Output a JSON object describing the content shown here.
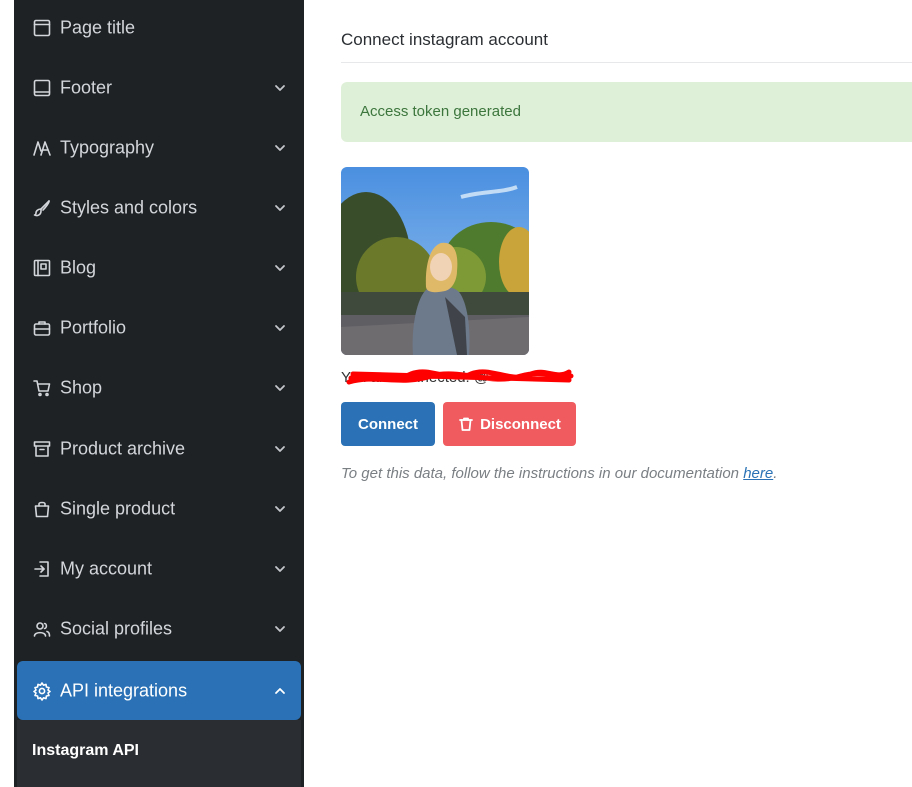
{
  "sidebar": {
    "items": [
      {
        "label": "Page title",
        "icon": "page-icon",
        "has_chevron": false
      },
      {
        "label": "Footer",
        "icon": "footer-icon",
        "has_chevron": true
      },
      {
        "label": "Typography",
        "icon": "typography-icon",
        "has_chevron": true
      },
      {
        "label": "Styles and colors",
        "icon": "brush-icon",
        "has_chevron": true
      },
      {
        "label": "Blog",
        "icon": "blog-icon",
        "has_chevron": true
      },
      {
        "label": "Portfolio",
        "icon": "briefcase-icon",
        "has_chevron": true
      },
      {
        "label": "Shop",
        "icon": "cart-icon",
        "has_chevron": true
      },
      {
        "label": "Product archive",
        "icon": "archive-icon",
        "has_chevron": true
      },
      {
        "label": "Single product",
        "icon": "bag-icon",
        "has_chevron": true
      },
      {
        "label": "My account",
        "icon": "login-icon",
        "has_chevron": true
      },
      {
        "label": "Social profiles",
        "icon": "users-icon",
        "has_chevron": true
      },
      {
        "label": "API integrations",
        "icon": "gear-icon",
        "has_chevron": true,
        "active": true,
        "expanded": true
      }
    ],
    "sub_items": [
      {
        "label": "Instagram API",
        "active": true
      }
    ]
  },
  "main": {
    "title": "Connect instagram account",
    "alert": "Access token generated",
    "username": "You are connected: @",
    "connect_label": "Connect",
    "disconnect_label": "Disconnect",
    "help_text": "To get this data, follow the instructions in our documentation ",
    "help_link": "here",
    "help_end": "."
  },
  "colors": {
    "sidebar_bg": "#1f2225",
    "accent": "#2a72b5",
    "danger": "#ef5b5f",
    "success_bg": "#dff0d8",
    "success_text": "#3c763d",
    "redaction": "#ff0000"
  }
}
